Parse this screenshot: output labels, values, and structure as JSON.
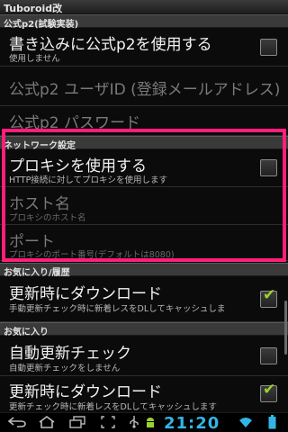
{
  "app": {
    "title": "Tuboroid改"
  },
  "sections": {
    "p2": "公式p2(試験実装)",
    "network": "ネットワーク設定",
    "favorites_history": "お気に入り/履歴",
    "favorites": "お気に入り"
  },
  "prefs": {
    "use_p2": {
      "title": "書き込みに公式p2を使用する",
      "summary": "使用しません",
      "checked": false
    },
    "p2_user": {
      "title": "公式p2 ユーザID (登録メールアドレス)"
    },
    "p2_password": {
      "title": "公式p2 パスワード"
    },
    "use_proxy": {
      "title": "プロキシを使用する",
      "summary": "HTTP接続に対してプロキシを使用します",
      "checked": false
    },
    "host": {
      "title": "ホスト名",
      "summary": "プロキシのホスト名"
    },
    "port": {
      "title": "ポート",
      "summary": "プロキシのポート番号(デフォルトは8080)"
    },
    "history_download": {
      "title": "更新時にダウンロード",
      "summary": "手動更新チェック時に新着レスをDLしてキャッシュしま",
      "checked": true
    },
    "auto_check": {
      "title": "自動更新チェック",
      "summary": "自動更新チェックをしません",
      "checked": false
    },
    "fav_download": {
      "title": "更新時にダウンロード",
      "summary": "更新チェック時に新着レスをDLしてキャッシュします",
      "checked": true
    }
  },
  "status": {
    "time": "21:20"
  },
  "colors": {
    "highlight": "#ff1f7a",
    "check": "#9ad131",
    "time": "#33b5e5"
  },
  "icons": [
    "back-icon",
    "home-icon",
    "recent-apps-icon",
    "screenshot-icon",
    "usb-icon",
    "android-icon",
    "wifi-icon",
    "battery-icon"
  ]
}
